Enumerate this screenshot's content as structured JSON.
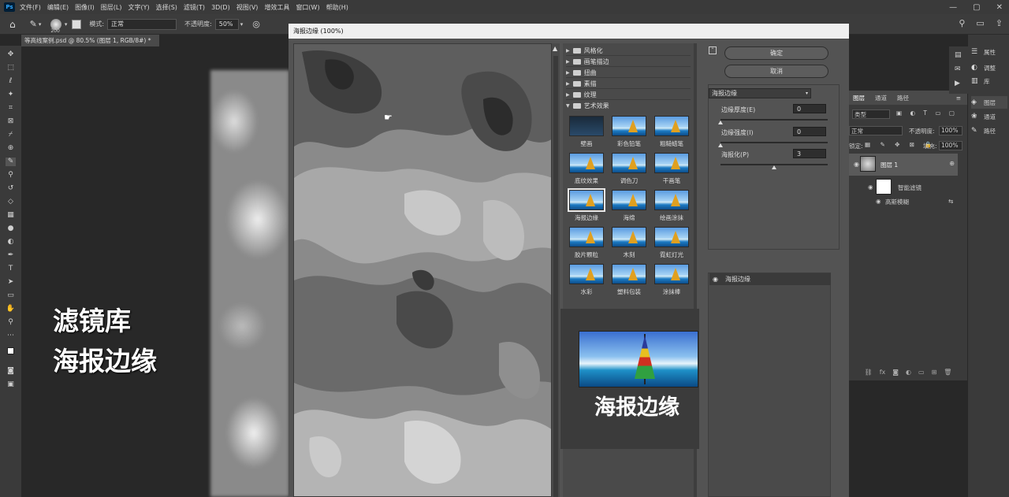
{
  "menubar": {
    "app_icon": "Ps",
    "items": [
      "文件(F)",
      "编辑(E)",
      "图像(I)",
      "图层(L)",
      "文字(Y)",
      "选择(S)",
      "滤镜(T)",
      "3D(D)",
      "视图(V)",
      "增效工具",
      "窗口(W)",
      "帮助(H)"
    ],
    "window_controls": [
      "—",
      "▢",
      "✕"
    ]
  },
  "options": {
    "brush_size": "200",
    "mode_label": "模式:",
    "mode_value": "正常",
    "opacity_label": "不透明度:",
    "opacity_value": "50%"
  },
  "document_tab": "等高线案例.psd @ 80.5% (图层 1, RGB/8#) *",
  "canvas_title": [
    "滤镜库",
    "海报边缘"
  ],
  "dialog": {
    "title": "海报边缘 (100%)",
    "categories": [
      "风格化",
      "画笔描边",
      "扭曲",
      "素描",
      "纹理",
      "艺术效果"
    ],
    "thumbnails": [
      {
        "label": "壁画",
        "style": "dark"
      },
      {
        "label": "彩色铅笔",
        "style": "normal"
      },
      {
        "label": "粗糙蜡笔",
        "style": "normal"
      },
      {
        "label": "底纹效果",
        "style": "normal"
      },
      {
        "label": "调色刀",
        "style": "normal"
      },
      {
        "label": "干画笔",
        "style": "normal"
      },
      {
        "label": "海报边缘",
        "style": "selected"
      },
      {
        "label": "海绵",
        "style": "normal"
      },
      {
        "label": "绘画涂抹",
        "style": "normal"
      },
      {
        "label": "胶片颗粒",
        "style": "normal"
      },
      {
        "label": "木刻",
        "style": "normal"
      },
      {
        "label": "霓虹灯光",
        "style": "normal"
      },
      {
        "label": "水彩",
        "style": "normal"
      },
      {
        "label": "塑料包装",
        "style": "normal"
      },
      {
        "label": "涂抹棒",
        "style": "normal"
      }
    ],
    "ok_label": "确定",
    "cancel_label": "取消",
    "filter_select": "海报边缘",
    "params": [
      {
        "label": "边缘厚度(E)",
        "value": "0",
        "level": 0
      },
      {
        "label": "边缘强度(I)",
        "value": "0",
        "level": 0
      },
      {
        "label": "海报化(P)",
        "value": "3",
        "level": 0.5
      }
    ],
    "layer_item": "海报边缘",
    "overlay_caption": "海报边缘"
  },
  "layers_panel": {
    "tabs": [
      "图层",
      "通道",
      "路径"
    ],
    "kind_label": "类型",
    "blend_mode": "正常",
    "opacity_label": "不透明度:",
    "opacity_value": "100%",
    "lock_label": "锁定:",
    "fill_label": "填充:",
    "fill_value": "100%",
    "layer_name": "图层 1",
    "smart_filter_label": "智能滤镜",
    "gaussian_label": "高斯模糊"
  },
  "right_dock": {
    "items": [
      {
        "label": "属性",
        "icon": "properties-icon"
      },
      {
        "label": "调整",
        "icon": "adjustments-icon"
      },
      {
        "label": "库",
        "icon": "libraries-icon"
      },
      {
        "label": "图层",
        "icon": "layers-icon"
      },
      {
        "label": "通道",
        "icon": "channels-icon"
      },
      {
        "label": "路径",
        "icon": "paths-icon"
      }
    ]
  }
}
